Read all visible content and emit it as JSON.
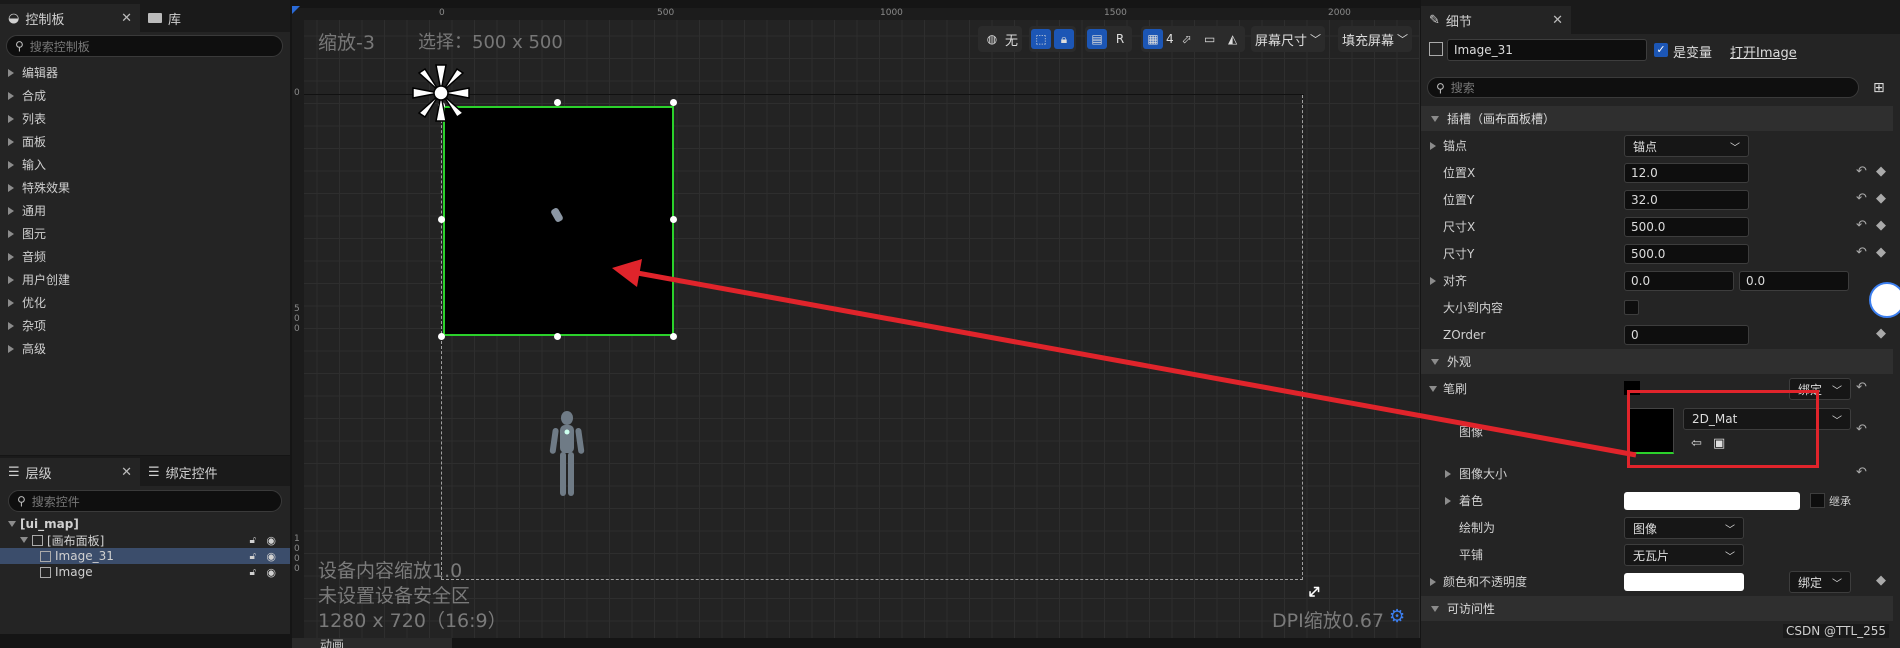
{
  "palette": {
    "tab_label": "控制板",
    "library_tab_label": "库",
    "search_placeholder": "搜索控制板",
    "categories": [
      "编辑器",
      "合成",
      "列表",
      "面板",
      "输入",
      "特殊效果",
      "通用",
      "图元",
      "音频",
      "用户创建",
      "优化",
      "杂项",
      "高级"
    ]
  },
  "hierarchy": {
    "tab_label": "层级",
    "bind_tab_label": "绑定控件",
    "search_placeholder": "搜索控件",
    "items": [
      {
        "label": "[ui_map]"
      },
      {
        "label": "[画布面板]"
      },
      {
        "label": "Image_31"
      },
      {
        "label": "Image"
      }
    ]
  },
  "bottom_tab": {
    "label": "动画"
  },
  "viewport": {
    "zoom_label": "缩放-3",
    "selection_label": "选择：500 x 500",
    "ruler_top": [
      "0",
      "500",
      "1000",
      "1500",
      "2000"
    ],
    "ruler_left": [
      "0",
      "500",
      "1000"
    ],
    "toolbar": {
      "world_label": "无",
      "r_label": "R",
      "grid_count": "4",
      "screen_size_label": "屏幕尺寸",
      "fill_screen_label": "填充屏幕"
    },
    "info_scale": "设备内容缩放1.0",
    "info_safezone": "未设置设备安全区",
    "info_resolution": "1280 x 720（16:9）",
    "dpi_label": "DPI缩放0.67"
  },
  "details": {
    "tab_label": "细节",
    "widget_name": "Image_31",
    "is_variable_label": "是变量",
    "open_label": "打开Image",
    "search_placeholder": "搜索",
    "slot_section": "插槽（画布面板槽）",
    "anchor_label": "锚点",
    "anchor_value": "锚点",
    "pos_x_label": "位置X",
    "pos_x_value": "12.0",
    "pos_y_label": "位置Y",
    "pos_y_value": "32.0",
    "size_x_label": "尺寸X",
    "size_x_value": "500.0",
    "size_y_label": "尺寸Y",
    "size_y_value": "500.0",
    "align_label": "对齐",
    "align_x_value": "0.0",
    "align_y_value": "0.0",
    "size_to_content_label": "大小到内容",
    "zorder_label": "ZOrder",
    "zorder_value": "0",
    "appearance_section": "外观",
    "brush_label": "笔刷",
    "bind_label": "绑定",
    "image_label": "图像",
    "image_asset": "2D_Mat",
    "image_size_label": "图像大小",
    "tint_label": "着色",
    "inherit_label": "继承",
    "draw_as_label": "绘制为",
    "draw_as_value": "图像",
    "tiling_label": "平铺",
    "tiling_value": "无瓦片",
    "color_opacity_label": "颜色和不透明度",
    "color_bind_label": "绑定",
    "accessibility_section": "可访问性"
  },
  "watermark": "CSDN @TTL_255",
  "colors": {
    "selection": "#2bd12b",
    "arrow": "#e0242b",
    "accent": "#1c56b5"
  }
}
